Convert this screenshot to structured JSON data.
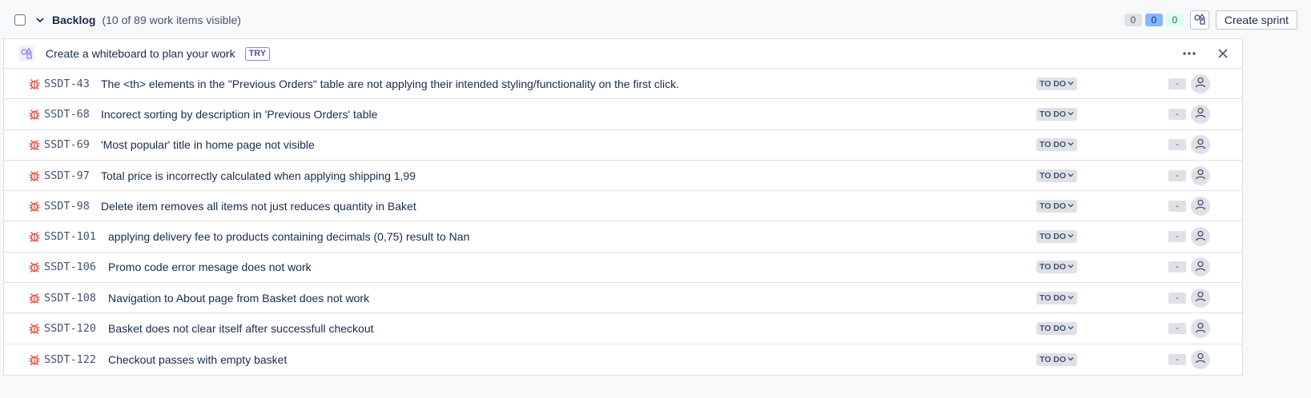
{
  "backlog": {
    "title": "Backlog",
    "count_text": "(10 of 89 work items visible)",
    "counts": {
      "todo": "0",
      "in_progress": "0",
      "done": "0"
    },
    "create_sprint_label": "Create sprint"
  },
  "banner": {
    "text": "Create a whiteboard to plan your work",
    "badge": "TRY"
  },
  "colors": {
    "bug": "#e2483d",
    "accent": "#0c66e4"
  },
  "items": [
    {
      "key": "SSDT-43",
      "summary": "The <th> elements in the \"Previous Orders\" table are not applying their intended styling/functionality on the first click.",
      "status": "TO DO",
      "estimate": "-"
    },
    {
      "key": "SSDT-68",
      "summary": "Incorect sorting by description in 'Previous Orders' table",
      "status": "TO DO",
      "estimate": "-"
    },
    {
      "key": "SSDT-69",
      "summary": "'Most popular' title in home page not visible",
      "status": "TO DO",
      "estimate": "-"
    },
    {
      "key": "SSDT-97",
      "summary": "Total price is incorrectly calculated when applying shipping 1,99",
      "status": "TO DO",
      "estimate": "-"
    },
    {
      "key": "SSDT-98",
      "summary": "Delete item removes all items not just reduces quantity in Baket",
      "status": "TO DO",
      "estimate": "-"
    },
    {
      "key": "SSDT-101",
      "summary": "applying delivery fee to products containing decimals (0,75) result to Nan",
      "status": "TO DO",
      "estimate": "-"
    },
    {
      "key": "SSDT-106",
      "summary": "Promo code error mesage does not work",
      "status": "TO DO",
      "estimate": "-"
    },
    {
      "key": "SSDT-108",
      "summary": "Navigation to About page from Basket does not work",
      "status": "TO DO",
      "estimate": "-"
    },
    {
      "key": "SSDT-120",
      "summary": "Basket does not clear itself after successfull checkout",
      "status": "TO DO",
      "estimate": "-"
    },
    {
      "key": "SSDT-122",
      "summary": "Checkout passes with empty basket",
      "status": "TO DO",
      "estimate": "-"
    }
  ]
}
